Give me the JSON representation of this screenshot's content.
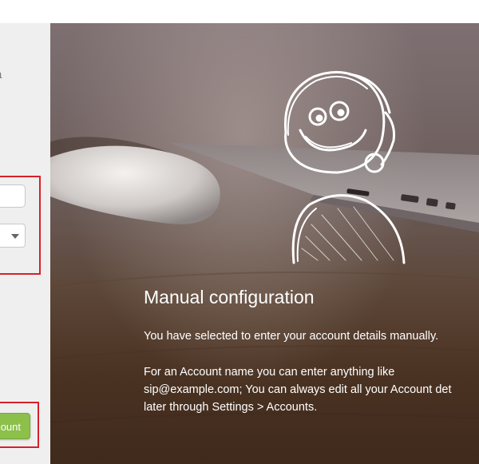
{
  "left": {
    "cut_text": "a",
    "account_button_label": "ount"
  },
  "right": {
    "title": "Manual configuration",
    "para1": "You have selected to enter your account details manually.",
    "para2": "For an Account name you can enter anything like\nsip@example.com; You can always edit all your Account det\nlater through Settings > Accounts."
  },
  "colors": {
    "accent_button": "#8cc04a",
    "highlight": "#d6212a"
  }
}
